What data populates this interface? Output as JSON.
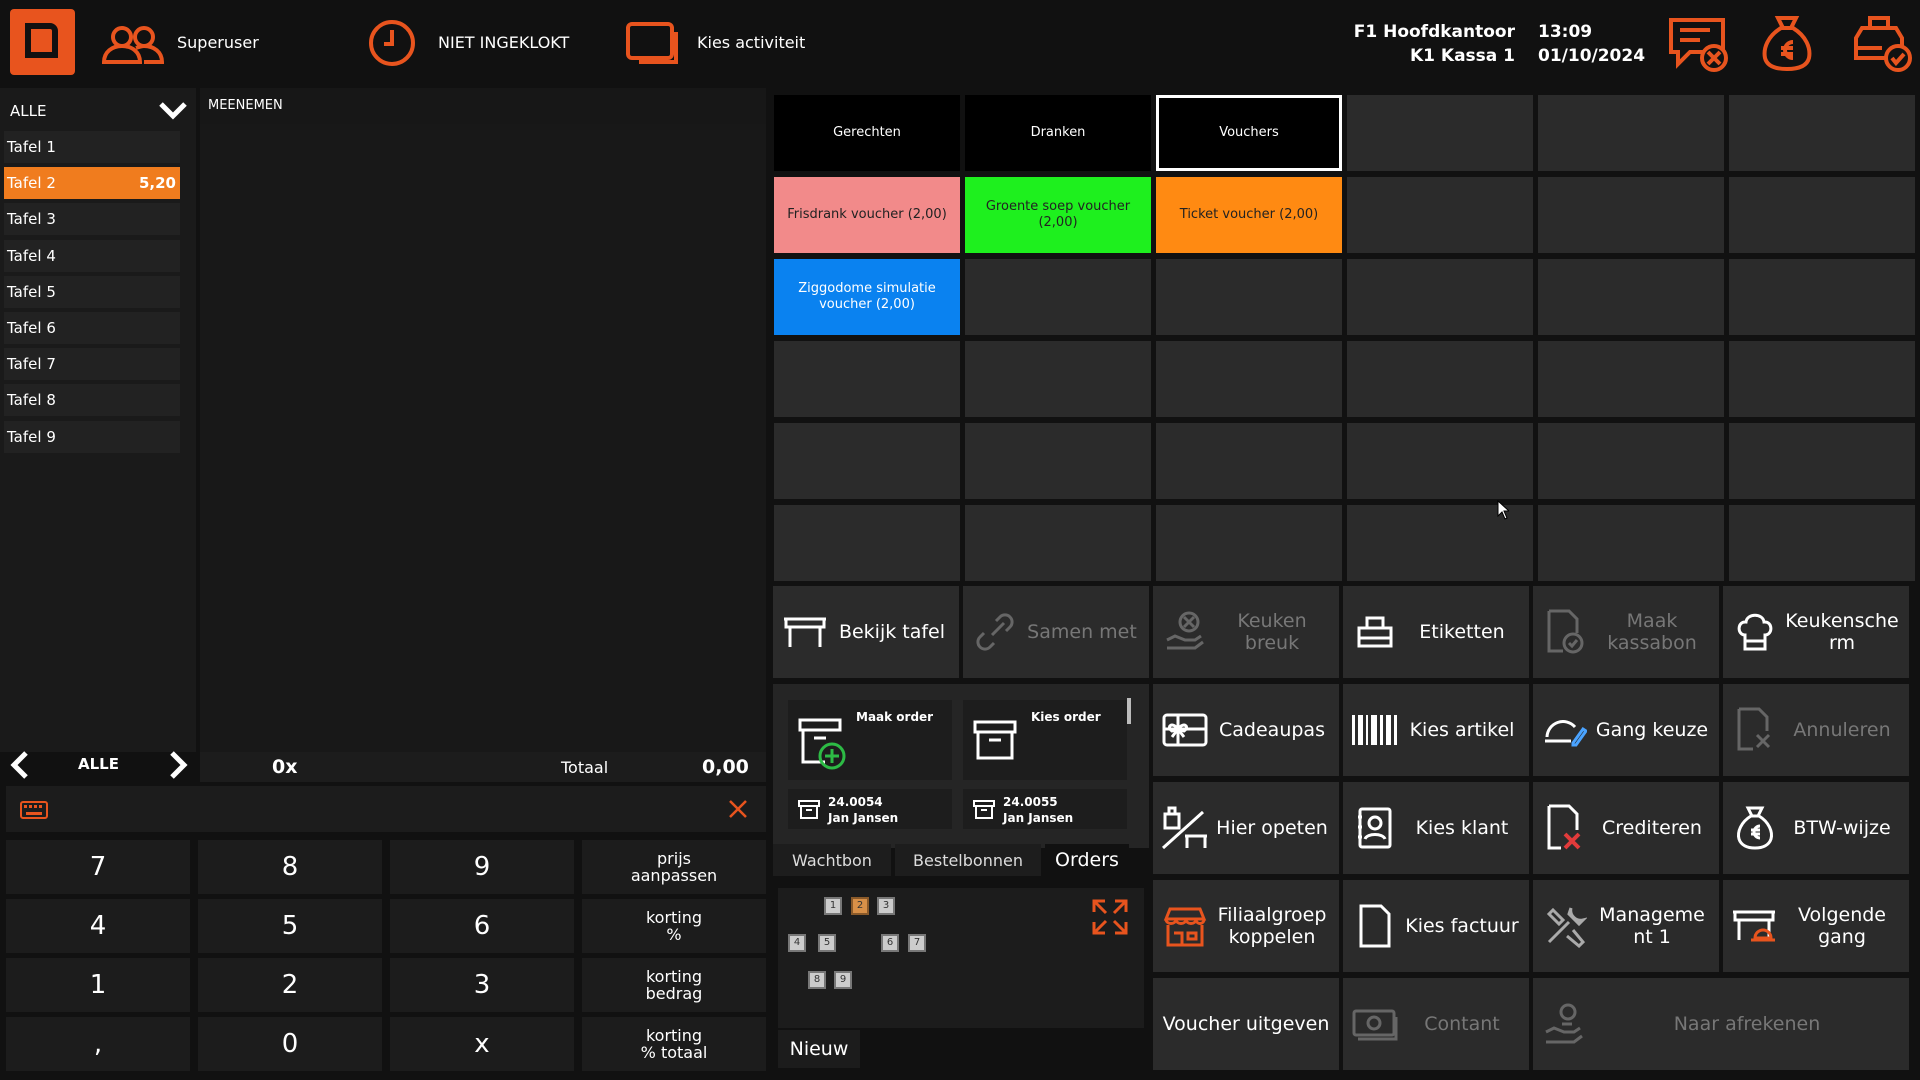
{
  "header": {
    "user": "Superuser",
    "clock_status": "NIET INGEKLOKT",
    "activity": "Kies activiteit",
    "branch": "F1 Hoofdkantoor",
    "register": "K1 Kassa 1",
    "time": "13:09",
    "date": "01/10/2024",
    "accent": "#e8541e"
  },
  "left": {
    "filter": "ALLE",
    "tables": [
      {
        "label": "Tafel 1",
        "amount": ""
      },
      {
        "label": "Tafel 2",
        "amount": "5,20"
      },
      {
        "label": "Tafel 3",
        "amount": ""
      },
      {
        "label": "Tafel 4",
        "amount": ""
      },
      {
        "label": "Tafel 5",
        "amount": ""
      },
      {
        "label": "Tafel 6",
        "amount": ""
      },
      {
        "label": "Tafel 7",
        "amount": ""
      },
      {
        "label": "Tafel 8",
        "amount": ""
      },
      {
        "label": "Tafel 9",
        "amount": ""
      }
    ],
    "pager_label": "ALLE"
  },
  "order": {
    "title": "MEENEMEN",
    "count": "0x",
    "total_label": "Totaal",
    "total": "0,00"
  },
  "numpad": {
    "keys": [
      "7",
      "8",
      "9",
      "4",
      "5",
      "6",
      "1",
      "2",
      "3",
      ",",
      "0",
      "x"
    ],
    "fn_keys": [
      "prijs\naanpassen",
      "korting\n%",
      "korting\nbedrag",
      "korting\n% totaal"
    ]
  },
  "categories": [
    {
      "label": "Gerechten"
    },
    {
      "label": "Dranken"
    },
    {
      "label": "Vouchers"
    }
  ],
  "products": [
    {
      "label": "Frisdrank voucher (2,00)",
      "color": "#f28a8a",
      "text_color": "#222"
    },
    {
      "label": "Groente soep voucher (2,00)",
      "color": "#1ef01e",
      "text_color": "#222"
    },
    {
      "label": "Ticket voucher (2,00)",
      "color": "#ff8a12",
      "text_color": "#222"
    },
    {
      "label": "Ziggodome simulatie voucher (2,00)",
      "color": "#0a82f0",
      "text_color": "#fff"
    }
  ],
  "functions": {
    "bekijk_tafel": "Bekijk tafel",
    "samen_met": "Samen met",
    "keuken_breuk": "Keuken breuk",
    "etiketten": "Etiketten",
    "maak_kassabon": "Maak kassabon",
    "keukenscherm": "Keukensche rm",
    "cadeaupas": "Cadeaupas",
    "kies_artikel": "Kies artikel",
    "gang_keuze": "Gang keuze",
    "annuleren": "Annuleren",
    "hier_opeten": "Hier opeten",
    "kies_klant": "Kies klant",
    "crediteren": "Crediteren",
    "btw_wijze": "BTW-wijze",
    "filiaalgroep": "Filiaalgroep koppelen",
    "kies_factuur": "Kies factuur",
    "management": "Manageme nt 1",
    "volgende_gang": "Volgende gang",
    "voucher_uitgeven": "Voucher uitgeven",
    "contant": "Contant",
    "naar_afrekenen": "Naar afrekenen"
  },
  "orders_panel": {
    "maak_order": "Maak order",
    "kies_order": "Kies order",
    "order1_no": "24.0054",
    "order1_name": "Jan Jansen",
    "order2_no": "24.0055",
    "order2_name": "Jan Jansen",
    "tabs": [
      "Wachtbon",
      "Bestelbonnen",
      "Orders"
    ],
    "mini_tables": [
      "1",
      "2",
      "3",
      "4",
      "5",
      "6",
      "7",
      "8",
      "9"
    ],
    "new_label": "Nieuw"
  }
}
